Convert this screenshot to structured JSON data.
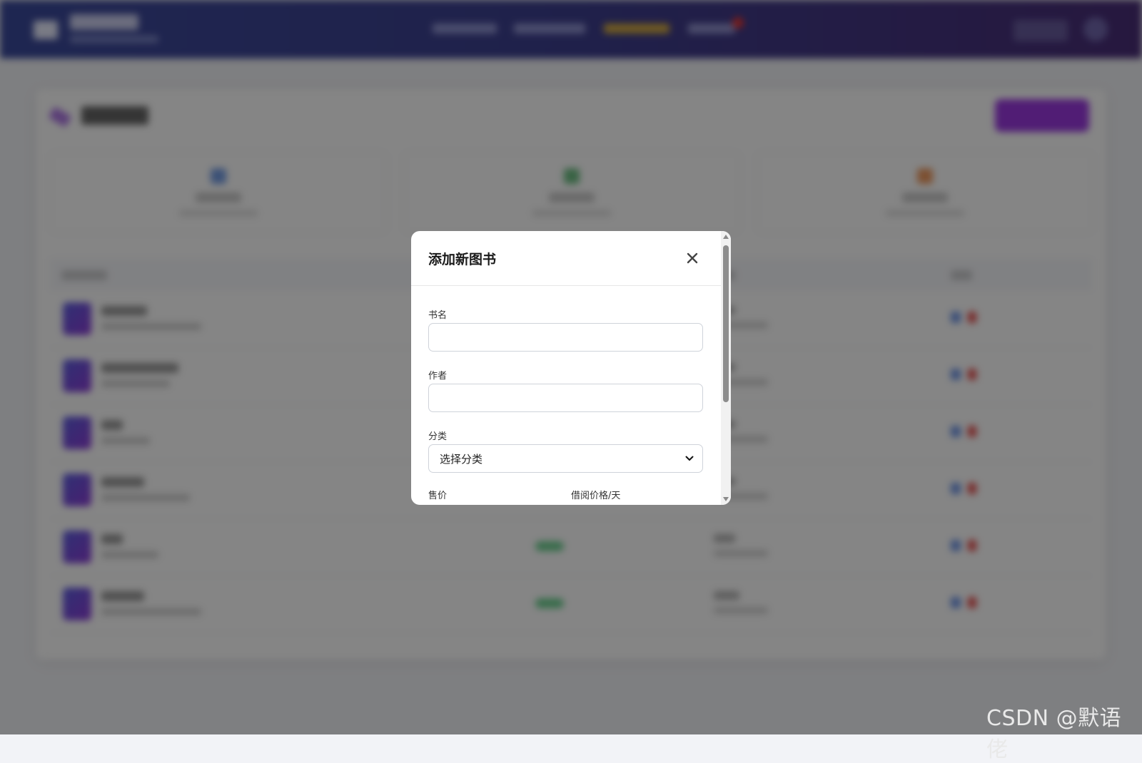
{
  "modal": {
    "title": "添加新图书",
    "close_icon": "close-icon",
    "fields": {
      "book_name_label": "书名",
      "author_label": "作者",
      "category_label": "分类",
      "category_selected": "选择分类",
      "sale_price_label": "售价",
      "rent_price_label": "借阅价格/天"
    }
  },
  "colors": {
    "accent": "#9b39e0",
    "nav_gradient_start": "#3b4a9c",
    "nav_gradient_end": "#4a2e78"
  },
  "watermark": "CSDN @默语佬"
}
